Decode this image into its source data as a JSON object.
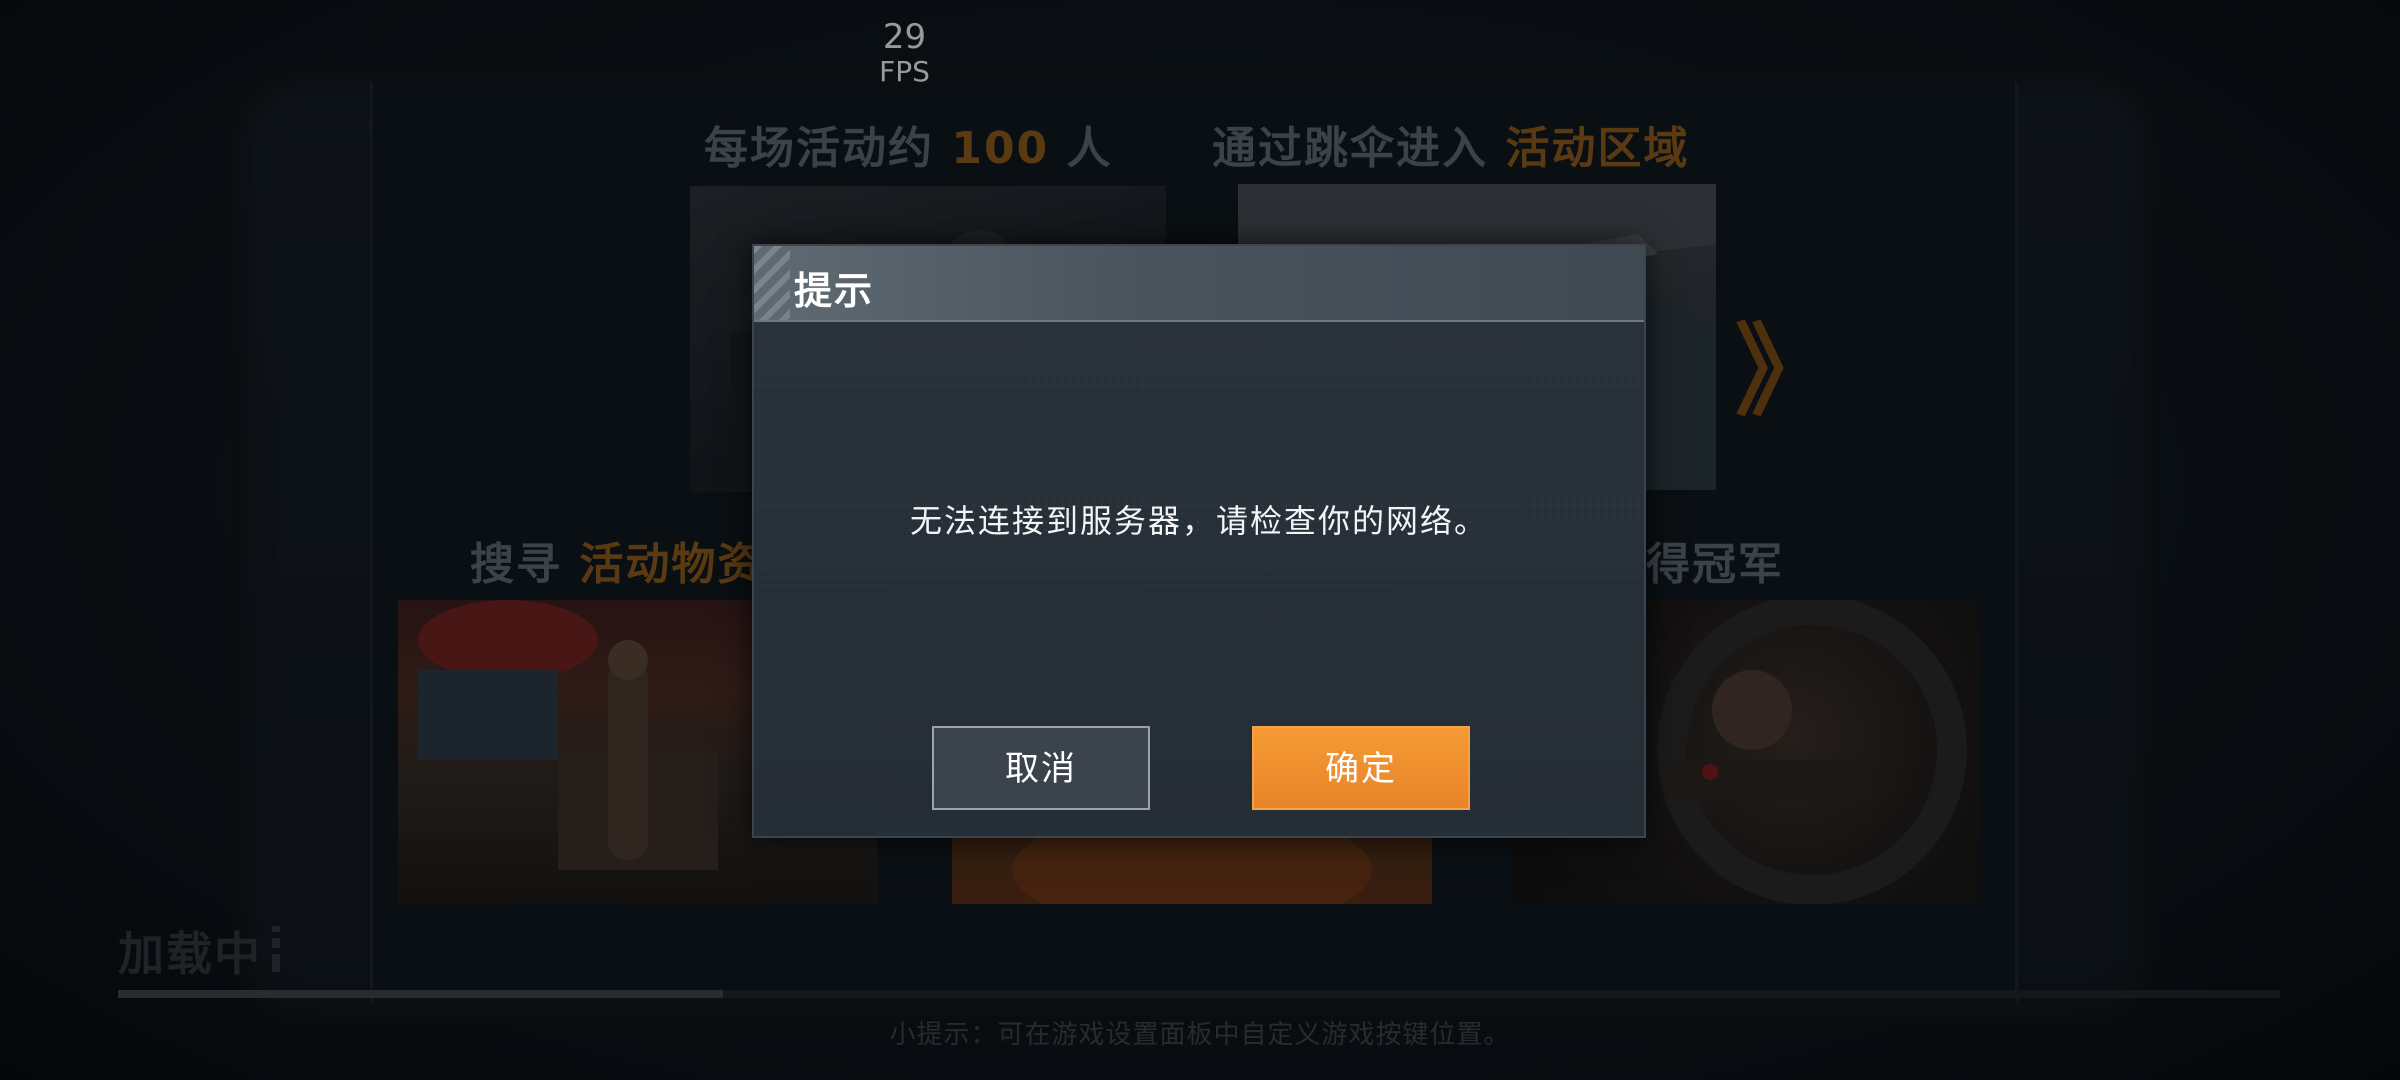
{
  "fps": {
    "value": "29",
    "label": "FPS"
  },
  "background": {
    "headings": [
      {
        "pre": "每场活动约 ",
        "highlight": "100",
        "post": " 人"
      },
      {
        "pre": "通过跳伞进入 ",
        "highlight": "活动区域",
        "post": ""
      },
      {
        "pre": "搜寻 ",
        "highlight": "活动物资",
        "post": ""
      },
      {
        "pre": "",
        "highlight": "",
        "post": "游，获得冠军"
      }
    ],
    "next_glyph": "》"
  },
  "loading": {
    "label": "加载中",
    "progress": 0.28
  },
  "tip": "小提示：可在游戏设置面板中自定义游戏按键位置。",
  "dialog": {
    "title": "提示",
    "message": "无法连接到服务器，请检查你的网络。",
    "cancel_label": "取消",
    "confirm_label": "确定"
  },
  "colors": {
    "accent": "#f0922f",
    "highlight_text": "#8a5a1c"
  }
}
